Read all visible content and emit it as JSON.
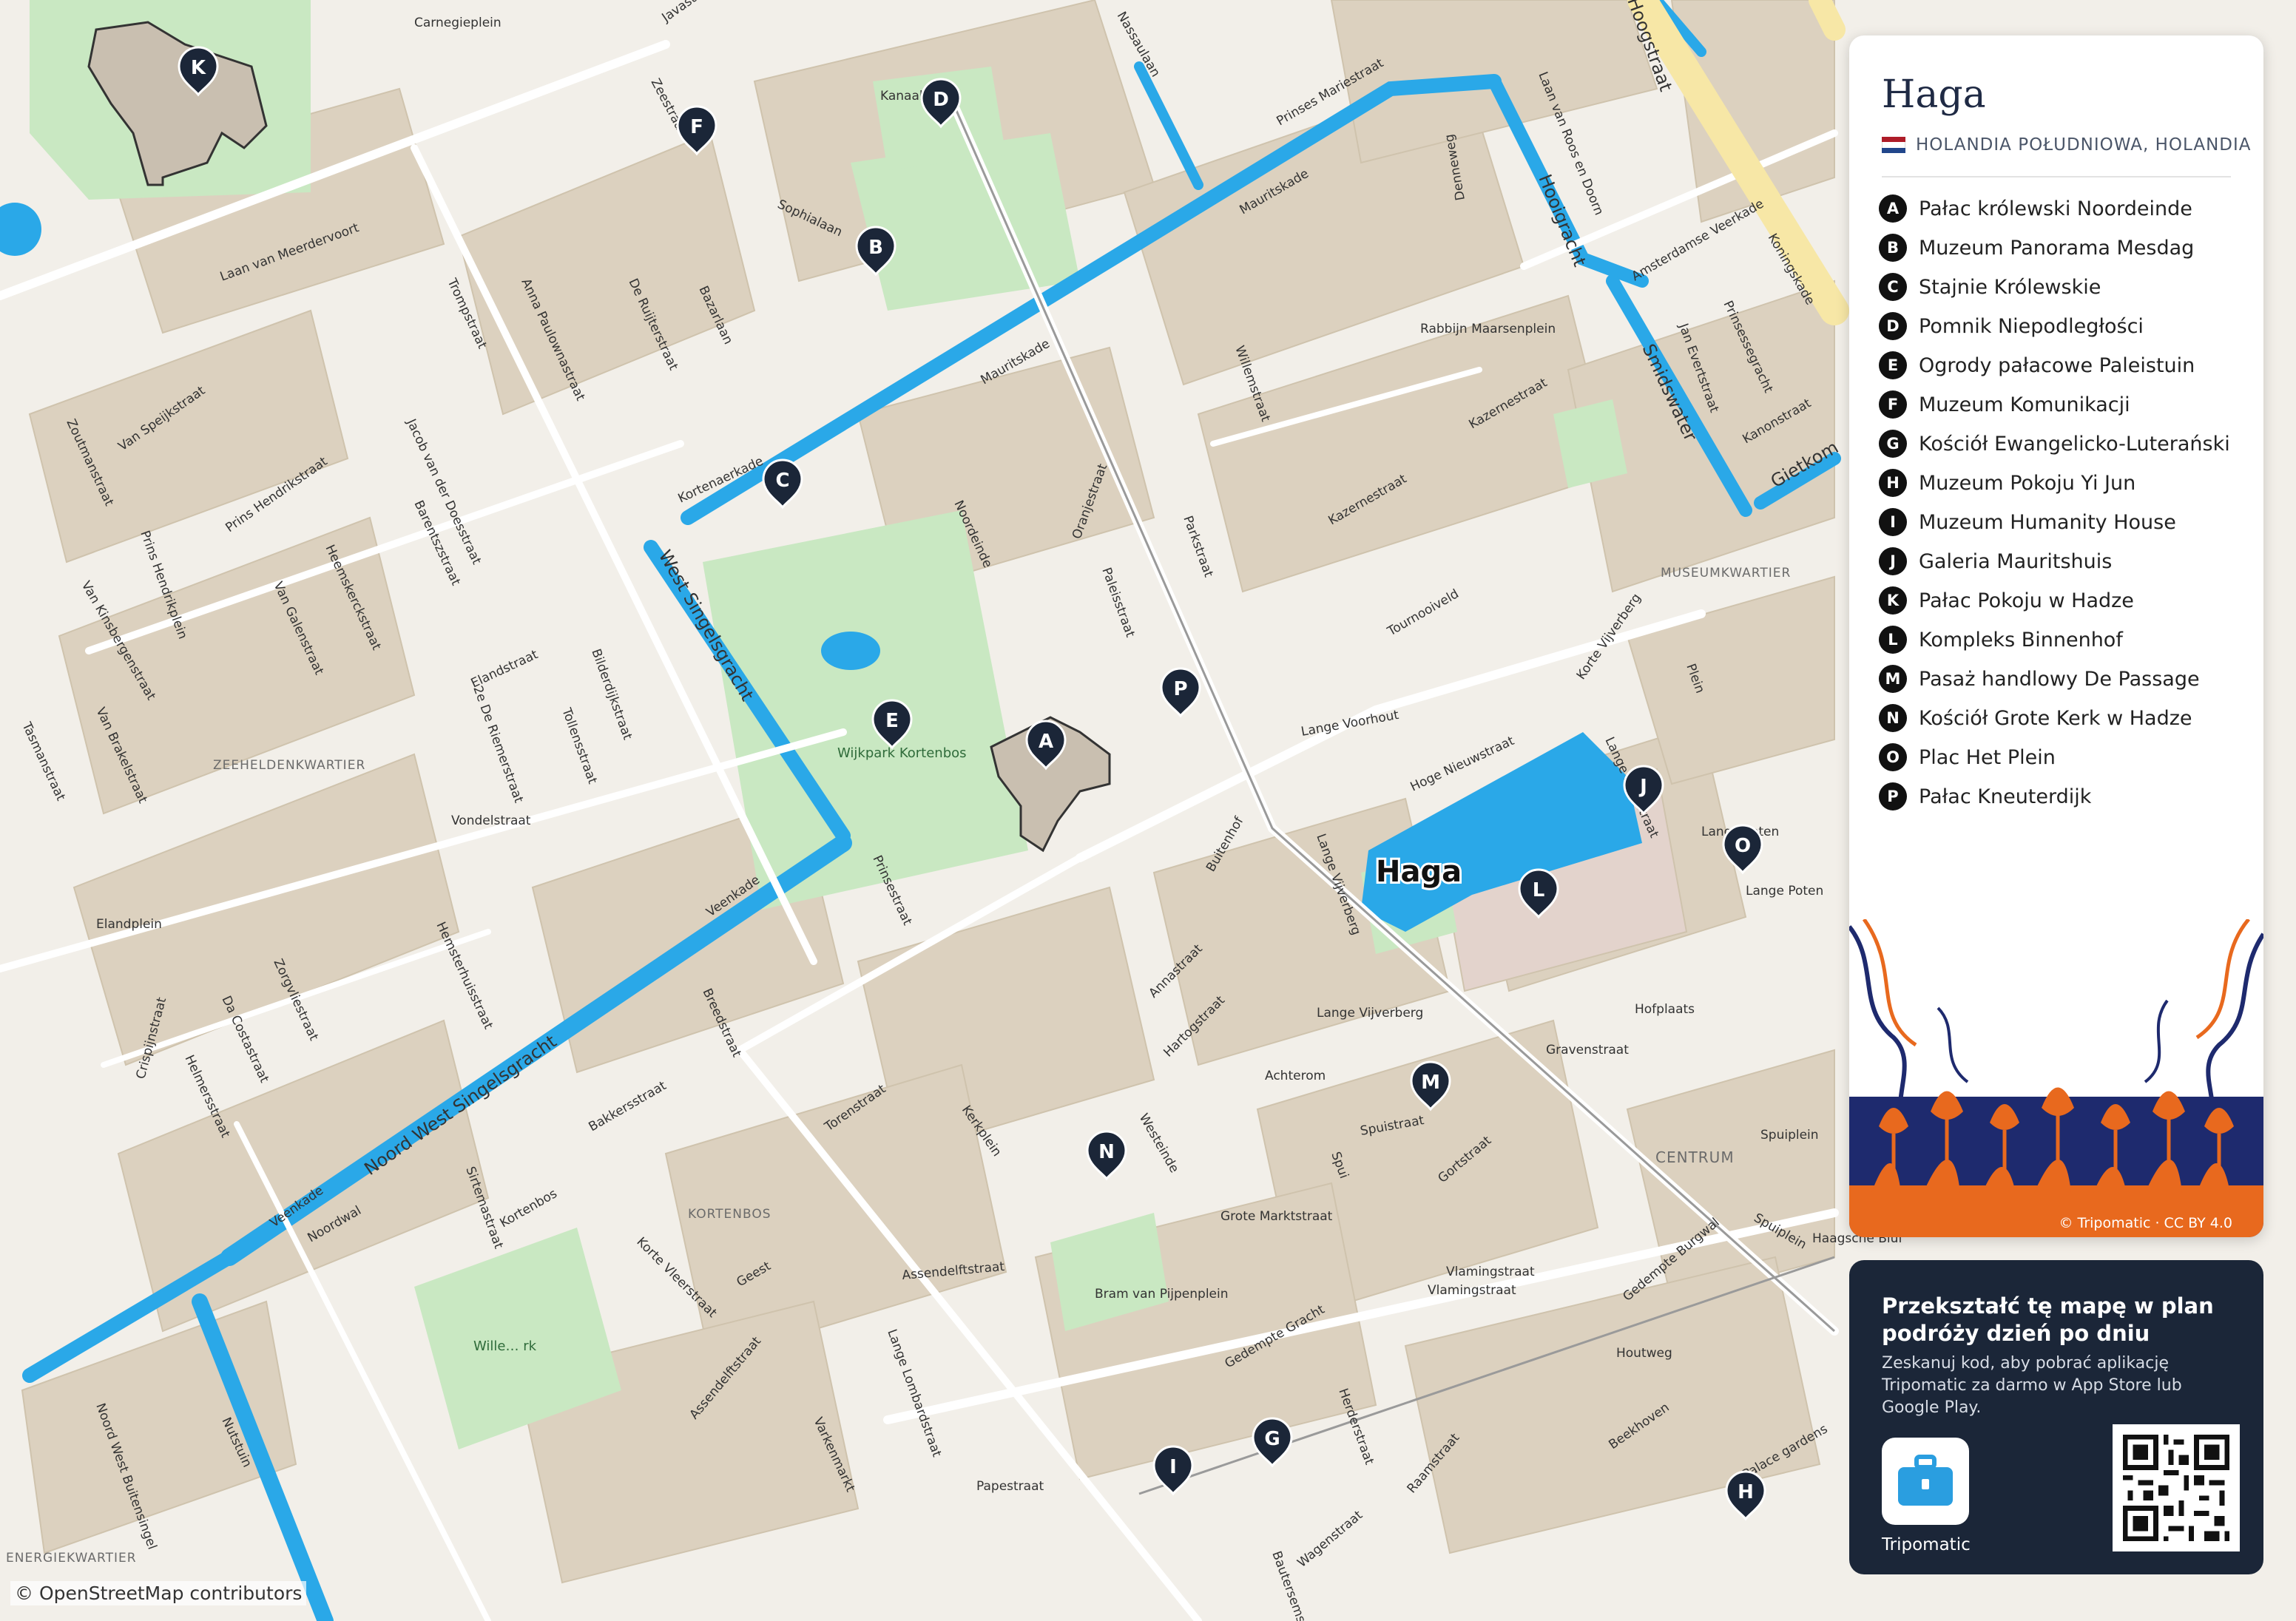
{
  "map": {
    "city_label": "Haga",
    "colors": {
      "land": "#f2efe9",
      "blocks": "#dcd1bf",
      "water": "#2aa8e8",
      "park": "#c9e8c2",
      "road": "#ffffff",
      "road_major": "#f7e7a6",
      "pin": "#1b2638"
    },
    "streets": [
      "Carnegieplein",
      "Javastraat",
      "Laan van Meerdervoort",
      "Zeestraat",
      "Sophialaan",
      "Nassaulaan",
      "Oranjestraat",
      "Prinses Mariestraat",
      "Mauritskade",
      "Laan van Roos en Doorn",
      "Hooigracht",
      "Hoogstraat",
      "Denneweg",
      "Koningskade",
      "Prinsessegracht",
      "Jan Evertstraat",
      "Smidswater",
      "Kanonstraat",
      "Gietkom",
      "Kazernestraat",
      "Willemstraat",
      "Parkstraat",
      "Paleisstraat",
      "Noordeinde",
      "Kortenaerkade",
      "Zoutmanstraat",
      "Van Speijkstraat",
      "Prins Hendrikstraat",
      "Prins Hendrikplein",
      "Van Kinsbergenstraat",
      "Tasmanstraat",
      "Van Brakelstraat",
      "Van Galenstraat",
      "Heemskerckstraat",
      "Barentszstraat",
      "Jacob van der Doesstraat",
      "Anna Paulownastraat",
      "De Ruijterstraat",
      "Trompstraat",
      "Bazarlaan",
      "Elandstraat",
      "Bilderdijkstraat",
      "Tollensstraat",
      "2e De Riemerstraat",
      "West Singelsgracht",
      "Vondelstraat",
      "Elandplein",
      "Zorgvliestraat",
      "Da Costastraat",
      "Helmersstraat",
      "Crispijnstraat",
      "Hemsterhuisstraat",
      "Veenkade",
      "Noord West Singelsgracht",
      "Bakkersstraat",
      "Breedstraat",
      "Prinsestraat",
      "Noordwal",
      "Sirtemastraat",
      "Kortenbos",
      "Korte Vleerstraat",
      "Geest",
      "Torenstraat",
      "Kerkplein",
      "Westeinde",
      "Assendelftstraat",
      "Lange Lombardstraat",
      "Varkenmarkt",
      "Papestraat",
      "Annastraat",
      "Hartogstraat",
      "Buitenhof",
      "Lange Vijverberg",
      "Hoge Nieuwstraat",
      "Lange Voorhout",
      "Tournooiveld",
      "Korte Vijverberg",
      "Lange Houtstraat",
      "Plein",
      "Lange Poten",
      "Hofplaats",
      "Gravenstraat",
      "Achterom",
      "Spuistraat",
      "Gortstraat",
      "Spui",
      "Spuiplein",
      "Haagsche Bluf",
      "Grote Marktstraat",
      "Vlamingstraat",
      "Gedempte Gracht",
      "Gedempte Burgwal",
      "Raamstraat",
      "Herderstraat",
      "Wagenstraat",
      "Beekhoven",
      "Bautersemstraat",
      "Noord West Buitensingel",
      "Nutstuin",
      "Bram van Pijpenplein",
      "Rabbijn Maarsenplein",
      "Houtweg",
      "Amsterdamse Veerkade",
      "Palace gardens",
      "Wijkpark Kortenbos",
      "Wille… rk",
      "Kanaal"
    ],
    "districts": [
      "ZEEHELDENKWARTIER",
      "MUSEUMKWARTIER",
      "CENTRUM",
      "KORTENBOS",
      "ENERGIEKWARTIER"
    ],
    "pins": [
      {
        "letter": "K"
      },
      {
        "letter": "D"
      },
      {
        "letter": "F"
      },
      {
        "letter": "B"
      },
      {
        "letter": "C"
      },
      {
        "letter": "E"
      },
      {
        "letter": "A"
      },
      {
        "letter": "P"
      },
      {
        "letter": "J"
      },
      {
        "letter": "O"
      },
      {
        "letter": "L"
      },
      {
        "letter": "M"
      },
      {
        "letter": "N"
      },
      {
        "letter": "G"
      },
      {
        "letter": "I"
      },
      {
        "letter": "H"
      }
    ]
  },
  "legend": {
    "title": "Haga",
    "region": "HOLANDIA POŁUDNIOWA, HOLANDIA",
    "flag_colors": [
      "#ae1c28",
      "#ffffff",
      "#21468b"
    ],
    "items": [
      {
        "letter": "A",
        "label": "Pałac królewski Noordeinde"
      },
      {
        "letter": "B",
        "label": "Muzeum Panorama Mesdag"
      },
      {
        "letter": "C",
        "label": "Stajnie Królewskie"
      },
      {
        "letter": "D",
        "label": "Pomnik Niepodległości"
      },
      {
        "letter": "E",
        "label": "Ogrody pałacowe Paleistuin"
      },
      {
        "letter": "F",
        "label": "Muzeum Komunikacji"
      },
      {
        "letter": "G",
        "label": "Kościół Ewangelicko-Luterański"
      },
      {
        "letter": "H",
        "label": "Muzeum Pokoju Yi Jun"
      },
      {
        "letter": "I",
        "label": "Muzeum Humanity House"
      },
      {
        "letter": "J",
        "label": "Galeria Mauritshuis"
      },
      {
        "letter": "K",
        "label": "Pałac Pokoju w Hadze"
      },
      {
        "letter": "L",
        "label": "Kompleks Binnenhof"
      },
      {
        "letter": "M",
        "label": "Pasaż handlowy De Passage"
      },
      {
        "letter": "N",
        "label": "Kościół Grote Kerk w Hadze"
      },
      {
        "letter": "O",
        "label": "Plac Het Plein"
      },
      {
        "letter": "P",
        "label": "Pałac Kneuterdijk"
      }
    ],
    "illustration_credit": "© Tripomatic · CC BY 4.0",
    "illustration_colors": [
      "#e8691e",
      "#1e2a6e"
    ]
  },
  "promo": {
    "heading": "Przekształć tę mapę w plan podróży dzień po dniu",
    "body": "Zeskanuj kod, aby pobrać aplikację Tripomatic za darmo w App Store lub Google Play.",
    "app_name": "Tripomatic",
    "app_color": "#2a9ee0"
  },
  "attribution": "© OpenStreetMap contributors"
}
